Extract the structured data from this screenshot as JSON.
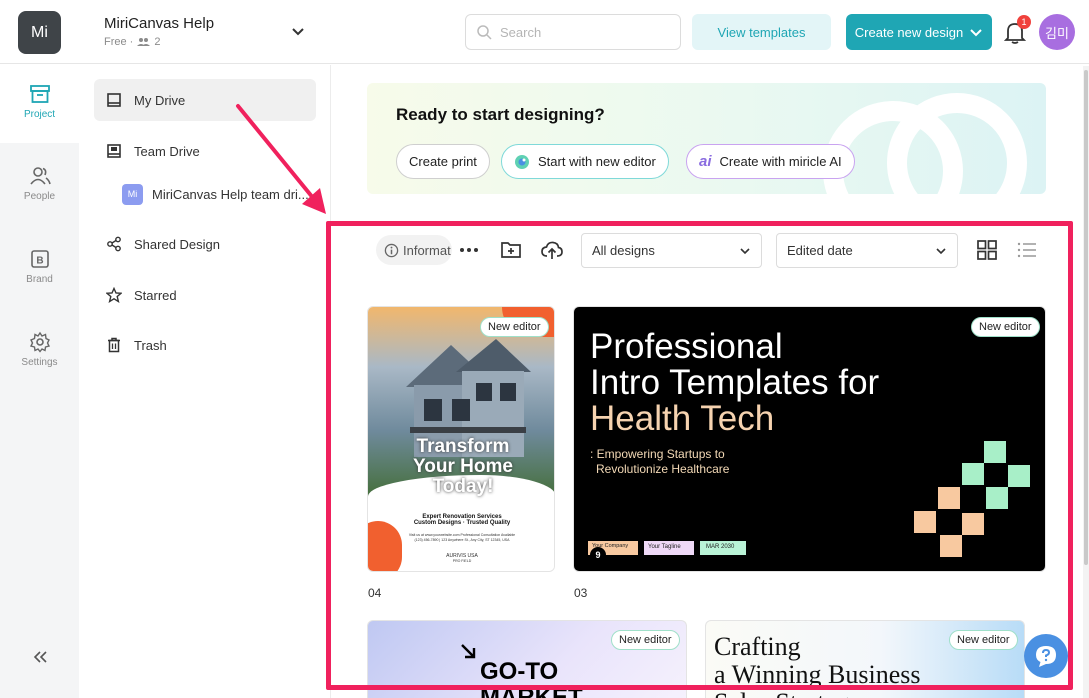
{
  "header": {
    "logo_text": "Mi",
    "workspace_name": "MiriCanvas Help",
    "workspace_plan": "Free ·",
    "member_count": "2",
    "search_placeholder": "Search",
    "view_templates": "View templates",
    "create_new_design": "Create new design",
    "notification_count": "1",
    "avatar_text": "김미"
  },
  "rail": {
    "items": [
      {
        "label": "Project",
        "icon": "archive-icon"
      },
      {
        "label": "People",
        "icon": "people-icon"
      },
      {
        "label": "Brand",
        "icon": "brand-icon"
      },
      {
        "label": "Settings",
        "icon": "gear-icon"
      }
    ]
  },
  "sidenav": {
    "my_drive": "My Drive",
    "team_drive": "Team Drive",
    "team_sub_logo": "Mi",
    "team_sub": "MiriCanvas Help team dri...",
    "shared_design": "Shared Design",
    "starred": "Starred",
    "trash": "Trash"
  },
  "banner": {
    "title": "Ready to start designing?",
    "create_print": "Create print",
    "start_new_editor": "Start with new editor",
    "create_ai": "Create with miricle AI",
    "ai_glyph": "ai"
  },
  "toolbar": {
    "info": "Informat",
    "filter": "All designs",
    "sort": "Edited date"
  },
  "cards": [
    {
      "badge": "New editor",
      "caption": "04",
      "headline": [
        "Transform",
        "Your Home",
        "Today!"
      ],
      "line1": "Expert Renovation Services",
      "line2": "Custom Designs · Trusted Quality",
      "fine": "Visit us at www.yourwebsite.com  Professional Consultation Available",
      "contact": "(123) 456-7890 | 123 Anywhere St., Any City, ST 12345, USA",
      "brand": "AURIVIS USA",
      "brand_sub": "PRO FIELD"
    },
    {
      "badge": "New editor",
      "caption": "03",
      "title_line1": "Professional",
      "title_line2": "Intro Templates for",
      "title_line3": "Health Tech",
      "subtitle_line1": ": Empowering Startups to",
      "subtitle_line2": "Revolutionize Healthcare",
      "tag1": "Your Company",
      "tag2": "Your Tagline",
      "tag3": "MAR 2030",
      "page_num": "9"
    },
    {
      "badge": "New editor",
      "headline1": "GO-TO",
      "headline2": "MARKET"
    },
    {
      "badge": "New editor",
      "headline1": "Crafting",
      "headline2": "a Winning Business",
      "headline3": "Sales Strategy"
    }
  ],
  "colors": {
    "accent": "#1fa6b4",
    "highlight": "#f0215d",
    "rail_bg": "#f4f5f6"
  }
}
